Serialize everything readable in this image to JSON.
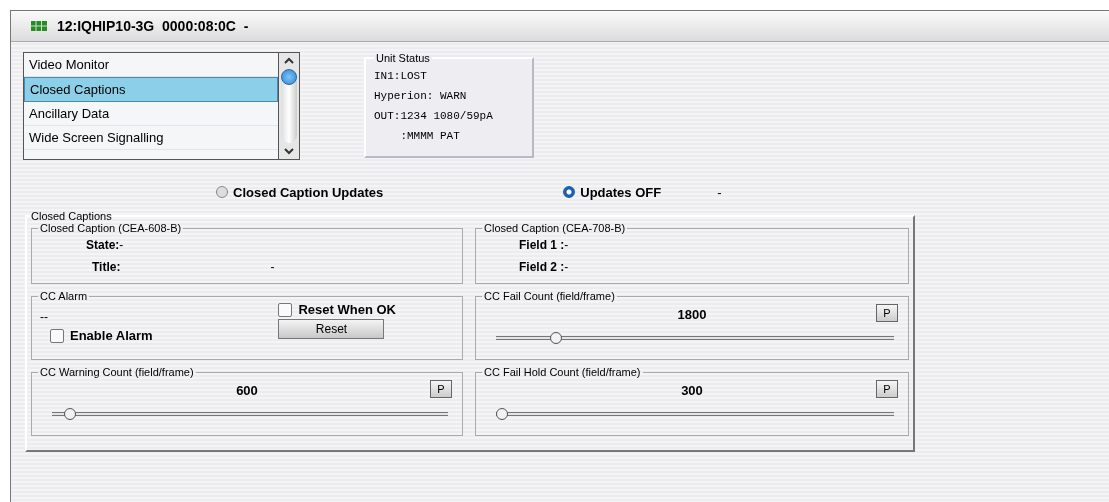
{
  "window": {
    "title": "12:IQHIP10-3G  0000:08:0C  -"
  },
  "menu_list": {
    "items": [
      {
        "label": "Video Monitor",
        "selected": false
      },
      {
        "label": "Closed Captions",
        "selected": true
      },
      {
        "label": "Ancillary Data",
        "selected": false
      },
      {
        "label": "Wide Screen Signalling",
        "selected": false
      }
    ]
  },
  "unit_status": {
    "title": "Unit Status",
    "lines": [
      "IN1:LOST",
      "Hyperion: WARN",
      "OUT:1234 1080/59pA",
      "    :MMMM PAT"
    ]
  },
  "update_mode": {
    "options": [
      {
        "label": "Closed Caption Updates",
        "selected": false
      },
      {
        "label": "Updates OFF",
        "selected": true
      }
    ],
    "status": "-"
  },
  "closed_captions": {
    "title": "Closed Captions",
    "cea608": {
      "title": "Closed Caption (CEA-608-B)",
      "state_label": "State:",
      "state_value": "-",
      "title_label": "Title:",
      "title_value": "-"
    },
    "cea708": {
      "title": "Closed Caption (CEA-708-B)",
      "field1_label": "Field 1 :",
      "field1_value": "-",
      "field2_label": "Field 2 :",
      "field2_value": "-"
    },
    "alarm": {
      "title": "CC Alarm",
      "status": "--",
      "reset_when_ok": {
        "label": "Reset When OK",
        "checked": false
      },
      "enable_alarm": {
        "label": "Enable Alarm",
        "checked": false
      },
      "reset_button": "Reset"
    },
    "counts": [
      {
        "title": "CC Fail Count (field/frame)",
        "value": "1800",
        "button": "P",
        "level": 0.14
      },
      {
        "title": "CC Warning Count (field/frame)",
        "value": "600",
        "button": "P",
        "level": 0.03
      },
      {
        "title": "CC Fail Hold Count (field/frame)",
        "value": "300",
        "button": "P",
        "level": 0.0
      }
    ]
  }
}
